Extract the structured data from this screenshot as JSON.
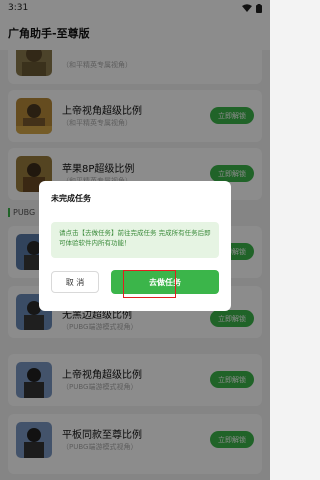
{
  "status_bar": {
    "time": "3:31"
  },
  "app": {
    "title": "广角助手-至尊版"
  },
  "cards": [
    {
      "title": "",
      "subtitle": "（和平精英专属视角）",
      "unlock_label": "立即解锁"
    },
    {
      "title": "上帝视角超级比例",
      "subtitle": "（和平精英专属视角）",
      "unlock_label": "立即解锁"
    },
    {
      "title": "苹果8P超级比例",
      "subtitle": "（和平精英专属视角）",
      "unlock_label": "立即解锁"
    },
    {
      "title": "",
      "subtitle": "",
      "unlock_label": "立即解锁"
    },
    {
      "title": "无黑边超级比例",
      "subtitle": "（PUBG端游模式视角）",
      "unlock_label": "立即解锁"
    },
    {
      "title": "上帝视角超级比例",
      "subtitle": "（PUBG端游模式视角）",
      "unlock_label": "立即解锁"
    },
    {
      "title": "平板同款至尊比例",
      "subtitle": "（PUBG端游模式视角）",
      "unlock_label": "立即解锁"
    }
  ],
  "section_label": "PUBG",
  "dialog": {
    "title": "未完成任务",
    "message": "请点击【去做任务】前往完成任务 完成所有任务后即可体验软件内所有功能！",
    "cancel_label": "取 消",
    "go_task_label": "去做任务"
  },
  "colors": {
    "accent": "#3bb54a",
    "highlight": "#e02020"
  }
}
